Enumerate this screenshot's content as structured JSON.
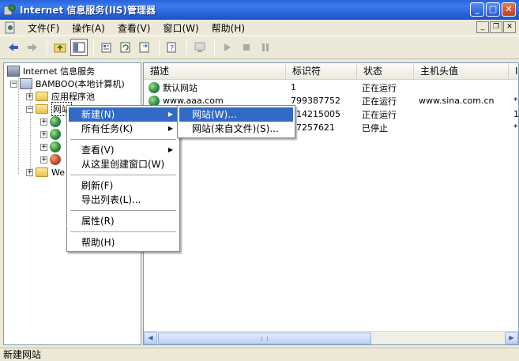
{
  "window": {
    "title": "Internet 信息服务(IIS)管理器",
    "controls": [
      "minimize",
      "maximize",
      "close"
    ]
  },
  "menubar": {
    "items": [
      "文件(F)",
      "操作(A)",
      "查看(V)",
      "窗口(W)",
      "帮助(H)"
    ]
  },
  "toolbar": {
    "buttons": [
      "back",
      "forward",
      "up",
      "show-hide-tree",
      "properties",
      "refresh",
      "export-list",
      "help",
      "computer",
      "play",
      "stop",
      "pause"
    ]
  },
  "tree": {
    "root": "Internet 信息服务",
    "computer": "BAMBOO(本地计算机)",
    "app_pools": "应用程序池",
    "websites": "网站",
    "web_ext": "We"
  },
  "list": {
    "columns": [
      "描述",
      "标识符",
      "状态",
      "主机头值",
      "I"
    ],
    "rows": [
      {
        "desc": "默认网站",
        "id": "1",
        "state": "正在运行",
        "host": "",
        "extra": ""
      },
      {
        "desc": "www.aaa.com",
        "id": "799387752",
        "state": "正在运行",
        "host": "www.sina.com.cn",
        "extra": "*"
      },
      {
        "desc": "",
        "id": "214215005",
        "state": "正在运行",
        "host": "",
        "extra": "1"
      },
      {
        "desc": "",
        "id": "37257621",
        "state": "已停止",
        "host": "",
        "extra": "*"
      }
    ]
  },
  "context_menu": {
    "items": [
      "新建(N)",
      "所有任务(K)",
      "查看(V)",
      "从这里创建窗口(W)",
      "刷新(F)",
      "导出列表(L)...",
      "属性(R)",
      "帮助(H)"
    ]
  },
  "submenu": {
    "items": [
      "网站(W)...",
      "网站(来自文件)(S)..."
    ]
  },
  "status": {
    "text": "新建网站"
  }
}
